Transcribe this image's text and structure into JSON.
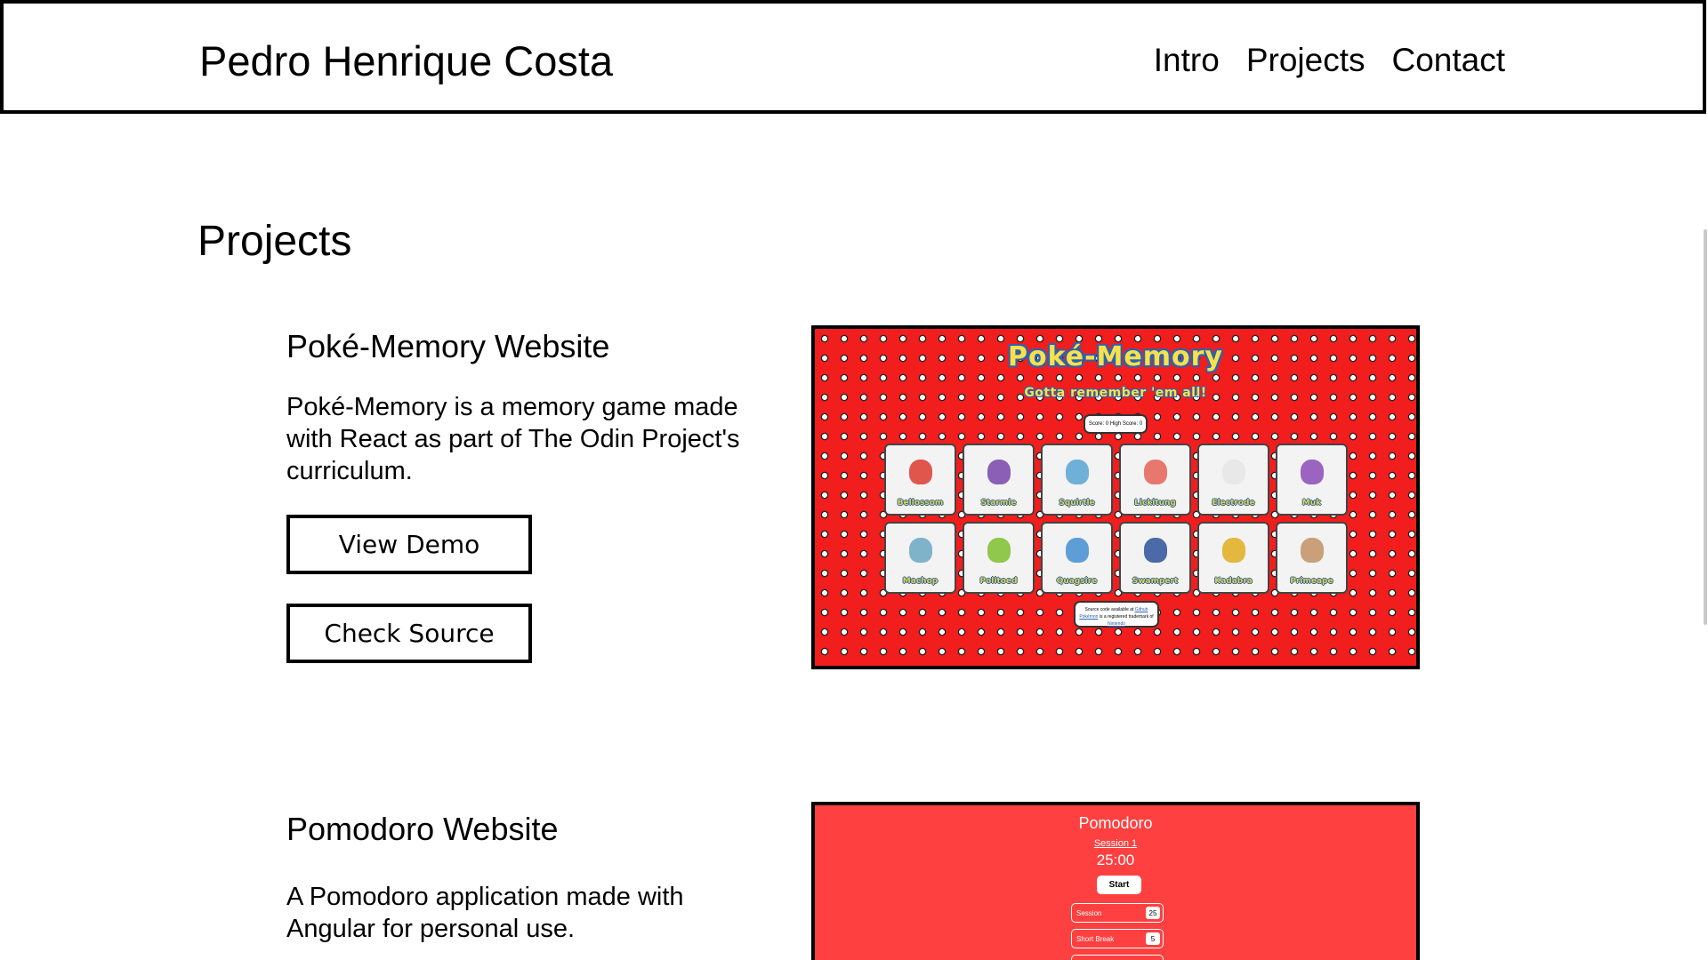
{
  "header": {
    "site_name": "Pedro Henrique Costa",
    "nav": [
      "Intro",
      "Projects",
      "Contact"
    ]
  },
  "projects_section": {
    "title": "Projects",
    "items": [
      {
        "title": "Poké-Memory Website",
        "description": "Poké-Memory is a memory game made with React as part of The Odin Project's curriculum.",
        "buttons": [
          "View Demo",
          "Check Source"
        ],
        "screenshot": {
          "app_title": "Poké-Memory",
          "tagline": "Gotta remember 'em all!",
          "score_label": "Score: 0",
          "high_score_label": "High Score: 0",
          "cards": [
            {
              "name": "Bellossom",
              "color": "#e0564c"
            },
            {
              "name": "Starmie",
              "color": "#8b5fb5"
            },
            {
              "name": "Squirtle",
              "color": "#6fb0d8"
            },
            {
              "name": "Lickitung",
              "color": "#e8786e"
            },
            {
              "name": "Electrode",
              "color": "#e8e8e8"
            },
            {
              "name": "Muk",
              "color": "#9b64c0"
            },
            {
              "name": "Machop",
              "color": "#7fb3c9"
            },
            {
              "name": "Politoed",
              "color": "#8fc84a"
            },
            {
              "name": "Quagsire",
              "color": "#5e9ed6"
            },
            {
              "name": "Swampert",
              "color": "#4a6aa8"
            },
            {
              "name": "Kadabra",
              "color": "#e3b83c"
            },
            {
              "name": "Primeape",
              "color": "#c9a07a"
            }
          ],
          "footer_line1": "Source code available at",
          "footer_link1": "Github",
          "footer_link2": "Pokémon",
          "footer_line2": "is a registered trademark of",
          "footer_link3": "Nintendo"
        }
      },
      {
        "title": "Pomodoro Website",
        "description": "A Pomodoro application made with Angular for personal use.",
        "screenshot": {
          "app_title": "Pomodoro",
          "session_label": "Session 1",
          "time": "25:00",
          "start_label": "Start",
          "settings": [
            {
              "label": "Session",
              "value": "25"
            },
            {
              "label": "Short Break",
              "value": "5"
            }
          ]
        }
      }
    ]
  }
}
